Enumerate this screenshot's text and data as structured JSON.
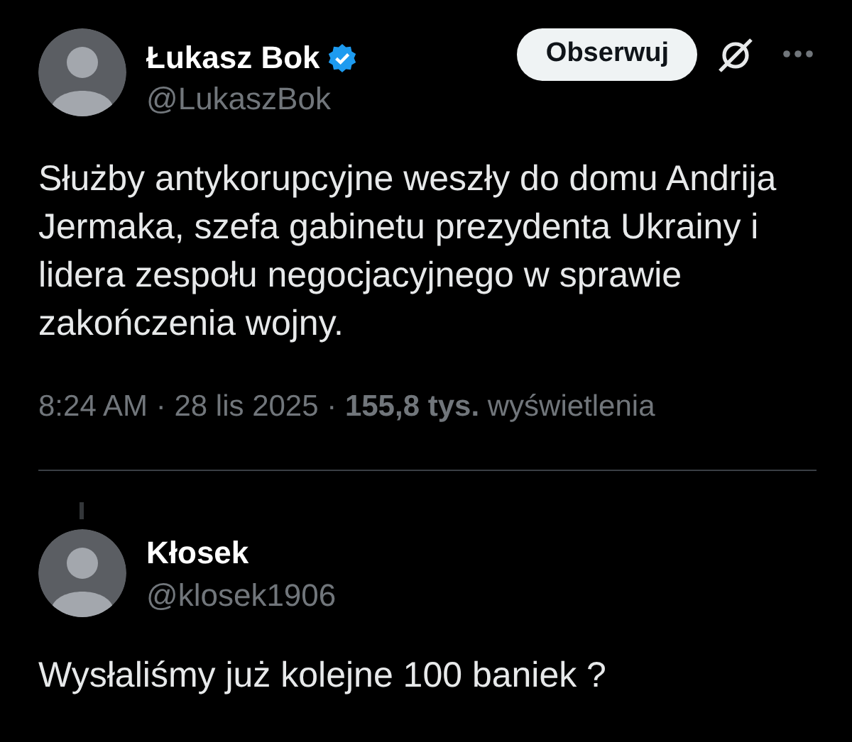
{
  "post": {
    "author": {
      "name": "Łukasz Bok",
      "handle": "@LukaszBok",
      "verified": true
    },
    "follow_button": "Obserwuj",
    "text": "Służby antykorupcyjne weszły do domu Andrija Jermaka, szefa gabinetu prezydenta Ukrainy i lidera zespołu negocjacyjnego w sprawie zakończenia wojny.",
    "meta": "8:24 AM · 28 lis 2025 · **155,8 tys.** wyświetlenia"
  },
  "reply": {
    "author": {
      "name": "Kłosek",
      "handle": "@klosek1906",
      "verified": false
    },
    "text": "Wysłaliśmy już kolejne 100 baniek ?"
  }
}
